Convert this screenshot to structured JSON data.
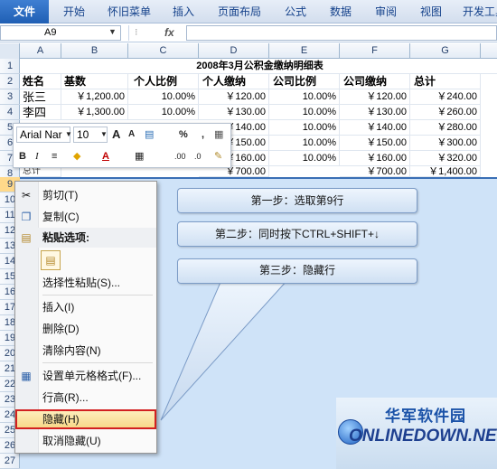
{
  "ribbon": {
    "tabs": [
      "文件",
      "开始",
      "怀旧菜单",
      "插入",
      "页面布局",
      "公式",
      "数据",
      "审阅",
      "视图",
      "开发工具"
    ]
  },
  "formula_bar": {
    "name_box": "A9",
    "fx": "fx",
    "value": ""
  },
  "columns": [
    "A",
    "B",
    "C",
    "D",
    "E",
    "F",
    "G"
  ],
  "rows": [
    "1",
    "2",
    "3",
    "4",
    "5",
    "6",
    "7",
    "8",
    "9",
    "10",
    "11",
    "12",
    "13",
    "14",
    "15",
    "16",
    "17",
    "18",
    "19",
    "20",
    "21",
    "22",
    "23",
    "24",
    "25",
    "26",
    "27"
  ],
  "sheet": {
    "title": "2008年3月公积金缴纳明细表",
    "headers": [
      "姓名",
      "基数",
      "个人比例",
      "个人缴纳",
      "公司比例",
      "公司缴纳",
      "总计"
    ],
    "data_rows": [
      [
        "张三",
        "￥1,200.00",
        "10.00%",
        "￥120.00",
        "10.00%",
        "￥120.00",
        "￥240.00"
      ],
      [
        "李四",
        "￥1,300.00",
        "10.00%",
        "￥130.00",
        "10.00%",
        "￥130.00",
        "￥260.00"
      ],
      [
        "",
        "",
        "",
        "￥140.00",
        "10.00%",
        "￥140.00",
        "￥280.00"
      ],
      [
        "",
        "",
        "",
        "￥150.00",
        "10.00%",
        "￥150.00",
        "￥300.00"
      ],
      [
        "",
        "",
        "",
        "￥160.00",
        "10.00%",
        "￥160.00",
        "￥320.00"
      ]
    ],
    "total_row": [
      "总计",
      "",
      "",
      "￥700.00",
      "",
      "￥700.00",
      "￥1,400.00"
    ]
  },
  "mini_toolbar": {
    "font": "Arial Nar",
    "size": "10",
    "grow_font": "A",
    "shrink_font": "A",
    "percent": "%",
    "comma": ",",
    "bold": "B",
    "italic": "I",
    "font_color_letter": "A",
    "dec_increase": ".00",
    "dec_decrease": ".0"
  },
  "context_menu": {
    "items": [
      {
        "label": "剪切(T)",
        "icon": "scissors-icon"
      },
      {
        "label": "复制(C)",
        "icon": "copy-icon"
      },
      {
        "label": "粘贴选项:",
        "icon": "paste-icon"
      },
      {
        "label": "选择性粘贴(S)...",
        "icon": ""
      },
      {
        "label": "插入(I)",
        "icon": ""
      },
      {
        "label": "删除(D)",
        "icon": ""
      },
      {
        "label": "清除内容(N)",
        "icon": ""
      },
      {
        "label": "设置单元格格式(F)...",
        "icon": "format-cells-icon"
      },
      {
        "label": "行高(R)...",
        "icon": ""
      },
      {
        "label": "隐藏(H)",
        "icon": ""
      },
      {
        "label": "取消隐藏(U)",
        "icon": ""
      }
    ]
  },
  "callouts": {
    "step1": "第一步：选取第9行",
    "step2": "第二步：同时按下CTRL+SHIFT+↓",
    "step3": "第三步：隐藏行"
  },
  "watermark": {
    "cn": "华军软件园",
    "en": "ONLINEDOWN.NET"
  },
  "colors": {
    "accent": "#1f5fb4",
    "highlight_border": "#d22020",
    "sheet_blue": "#cfe3f8"
  }
}
